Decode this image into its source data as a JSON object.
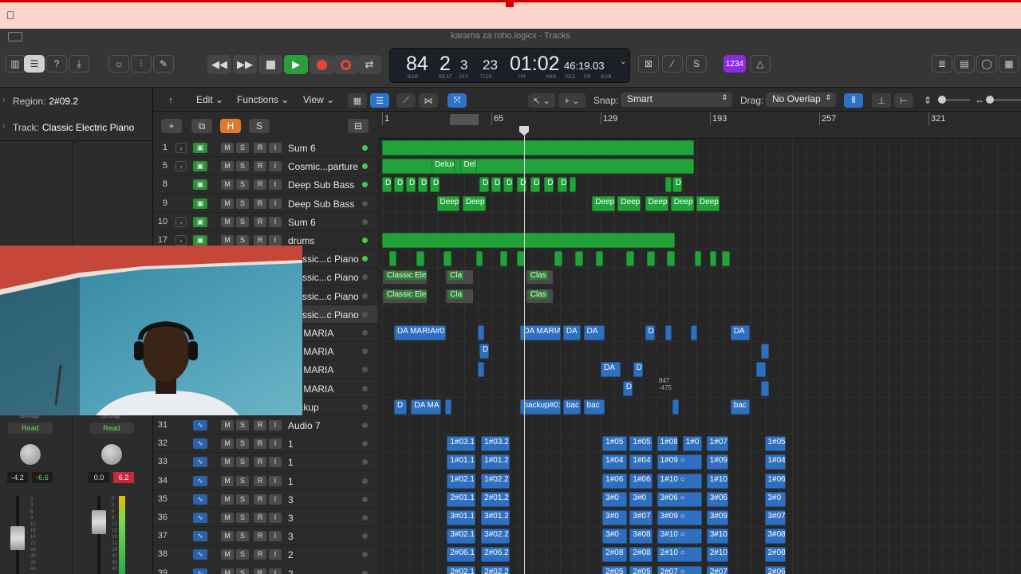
{
  "window": {
    "title": "karama za roho.logicx - Tracks"
  },
  "lcd": {
    "bar": "84",
    "beat": "2",
    "div": "3",
    "tick": "23",
    "time": "01:02",
    "time_small": "46:19.03",
    "labels": {
      "bar": "BAR",
      "beat": "BEAT",
      "div": "DIV",
      "tick": "TICK",
      "hr": "HR",
      "min": "MIN",
      "sec": "SEC",
      "fr": "FR",
      "sub": "SUB"
    }
  },
  "count_in": {
    "label": "1234"
  },
  "master_volume": {
    "level": 0.67
  },
  "inspector": {
    "region_label": "Region:",
    "region_value": "2#09.2",
    "track_label": "Track:",
    "track_value": "Classic Electric Piano",
    "strip_left": {
      "group": "Group",
      "automation": "Read",
      "vol": "-4.2",
      "peak": "-6.6"
    },
    "strip_right": {
      "group": "Group",
      "automation": "Read",
      "vol": "0.0",
      "peak": "6.2"
    }
  },
  "toolbar": {
    "edit": "Edit",
    "functions": "Functions",
    "view": "View",
    "snap_label": "Snap:",
    "snap_value": "Smart",
    "drag_label": "Drag:",
    "drag_value": "No Overlap"
  },
  "header_buttons": {
    "add": "+",
    "dup": "⧉",
    "hide": "H",
    "solo": "S"
  },
  "ruler": {
    "bars": [
      "1",
      "65",
      "129",
      "193",
      "257",
      "321"
    ]
  },
  "track_buttons": {
    "m": "M",
    "s": "S",
    "r": "R",
    "i": "I"
  },
  "tracks": [
    {
      "num": "1",
      "name": "Sum 6",
      "type": "inst",
      "stack": true,
      "led": true
    },
    {
      "num": "5",
      "name": "Cosmic...parture",
      "type": "inst",
      "stack": true,
      "led": true
    },
    {
      "num": "8",
      "name": "Deep Sub Bass",
      "type": "inst",
      "stack": false,
      "led": true
    },
    {
      "num": "9",
      "name": "Deep Sub Bass",
      "type": "inst",
      "stack": false,
      "led": false
    },
    {
      "num": "10",
      "name": "Sum 6",
      "type": "inst",
      "stack": true,
      "led": false
    },
    {
      "num": "17",
      "name": "drums",
      "type": "inst",
      "stack": true,
      "led": true
    },
    {
      "num": "",
      "name": "Classic...c Piano",
      "type": "inst",
      "stack": false,
      "led": true
    },
    {
      "num": "",
      "name": "Classic...c Piano",
      "type": "inst",
      "stack": false,
      "led": false
    },
    {
      "num": "",
      "name": "Classic...c Piano",
      "type": "inst",
      "stack": false,
      "led": false
    },
    {
      "num": "",
      "name": "Classic...c Piano",
      "type": "inst",
      "stack": false,
      "led": false
    },
    {
      "num": "",
      "name": "DA MARIA",
      "type": "audio",
      "stack": false,
      "led": false
    },
    {
      "num": "",
      "name": "DA MARIA",
      "type": "audio",
      "stack": false,
      "led": false
    },
    {
      "num": "",
      "name": "DA MARIA",
      "type": "audio",
      "stack": false,
      "led": false
    },
    {
      "num": "",
      "name": "DA MARIA",
      "type": "audio",
      "stack": false,
      "led": false
    },
    {
      "num": "",
      "name": "backup",
      "type": "audio",
      "stack": false,
      "led": false
    },
    {
      "num": "31",
      "name": "Audio 7",
      "type": "audio",
      "stack": false,
      "led": false
    },
    {
      "num": "32",
      "name": "1",
      "type": "audio",
      "stack": false,
      "led": false
    },
    {
      "num": "33",
      "name": "1",
      "type": "audio",
      "stack": false,
      "led": false
    },
    {
      "num": "34",
      "name": "1",
      "type": "audio",
      "stack": false,
      "led": false
    },
    {
      "num": "35",
      "name": "3",
      "type": "audio",
      "stack": false,
      "led": false
    },
    {
      "num": "36",
      "name": "3",
      "type": "audio",
      "stack": false,
      "led": false
    },
    {
      "num": "37",
      "name": "3",
      "type": "audio",
      "stack": false,
      "led": false
    },
    {
      "num": "38",
      "name": "2",
      "type": "audio",
      "stack": false,
      "led": false
    },
    {
      "num": "39",
      "name": "2",
      "type": "audio",
      "stack": false,
      "led": false
    }
  ],
  "regions": [
    {
      "lane": 0,
      "bar": 1,
      "len": 183,
      "label": "",
      "color": "g"
    },
    {
      "lane": 1,
      "bar": 1,
      "len": 183,
      "label": "",
      "color": "g"
    },
    {
      "lane": 1,
      "bar": 30,
      "len": 14,
      "label": "Deluxe",
      "color": "g"
    },
    {
      "lane": 1,
      "bar": 47,
      "len": 10,
      "label": "Delu",
      "color": "g"
    },
    {
      "lane": 2,
      "bar": 1,
      "len": 6,
      "label": "D",
      "color": "g"
    },
    {
      "lane": 2,
      "bar": 8,
      "len": 6,
      "label": "D",
      "color": "g"
    },
    {
      "lane": 2,
      "bar": 15,
      "len": 6,
      "label": "D",
      "color": "g"
    },
    {
      "lane": 2,
      "bar": 22,
      "len": 6,
      "label": "D",
      "color": "g"
    },
    {
      "lane": 2,
      "bar": 29,
      "len": 6,
      "label": "D",
      "color": "g"
    },
    {
      "lane": 2,
      "bar": 58,
      "len": 6,
      "label": "D",
      "color": "g"
    },
    {
      "lane": 2,
      "bar": 65,
      "len": 6,
      "label": "D",
      "color": "g"
    },
    {
      "lane": 2,
      "bar": 72,
      "len": 6,
      "label": "D",
      "color": "g"
    },
    {
      "lane": 2,
      "bar": 80,
      "len": 6,
      "label": "D",
      "color": "g"
    },
    {
      "lane": 2,
      "bar": 88,
      "len": 6,
      "label": "D",
      "color": "g"
    },
    {
      "lane": 2,
      "bar": 96,
      "len": 6,
      "label": "D",
      "color": "g"
    },
    {
      "lane": 2,
      "bar": 104,
      "len": 6,
      "label": "D",
      "color": "g"
    },
    {
      "lane": 2,
      "bar": 111,
      "len": 3,
      "label": "",
      "color": "g"
    },
    {
      "lane": 2,
      "bar": 167,
      "len": 3,
      "label": "",
      "color": "g"
    },
    {
      "lane": 2,
      "bar": 171,
      "len": 6,
      "label": "D",
      "color": "g"
    },
    {
      "lane": 3,
      "bar": 33,
      "len": 14,
      "label": "Deep",
      "color": "g"
    },
    {
      "lane": 3,
      "bar": 48,
      "len": 14,
      "label": "Deep",
      "color": "g"
    },
    {
      "lane": 3,
      "bar": 124,
      "len": 14,
      "label": "Deep",
      "color": "g"
    },
    {
      "lane": 3,
      "bar": 139,
      "len": 14,
      "label": "Deep",
      "color": "g"
    },
    {
      "lane": 3,
      "bar": 155,
      "len": 14,
      "label": "Deep",
      "color": "g"
    },
    {
      "lane": 3,
      "bar": 170,
      "len": 14,
      "label": "Deep",
      "color": "g"
    },
    {
      "lane": 3,
      "bar": 185,
      "len": 14,
      "label": "Deep",
      "color": "g"
    },
    {
      "lane": 5,
      "bar": 1,
      "len": 172,
      "label": "",
      "color": "g"
    },
    {
      "lane": 6,
      "bar": 5,
      "len": 5,
      "label": "",
      "color": "g"
    },
    {
      "lane": 6,
      "bar": 21,
      "len": 5,
      "label": "",
      "color": "g"
    },
    {
      "lane": 6,
      "bar": 37,
      "len": 5,
      "label": "",
      "color": "g"
    },
    {
      "lane": 6,
      "bar": 56,
      "len": 3,
      "label": "",
      "color": "g"
    },
    {
      "lane": 6,
      "bar": 70,
      "len": 5,
      "label": "",
      "color": "g"
    },
    {
      "lane": 6,
      "bar": 80,
      "len": 5,
      "label": "",
      "color": "g"
    },
    {
      "lane": 6,
      "bar": 102,
      "len": 5,
      "label": "",
      "color": "g"
    },
    {
      "lane": 6,
      "bar": 114,
      "len": 5,
      "label": "",
      "color": "g"
    },
    {
      "lane": 6,
      "bar": 126,
      "len": 5,
      "label": "",
      "color": "g"
    },
    {
      "lane": 6,
      "bar": 144,
      "len": 5,
      "label": "",
      "color": "g"
    },
    {
      "lane": 6,
      "bar": 156,
      "len": 5,
      "label": "",
      "color": "g"
    },
    {
      "lane": 6,
      "bar": 168,
      "len": 5,
      "label": "",
      "color": "g"
    },
    {
      "lane": 6,
      "bar": 184,
      "len": 3,
      "label": "",
      "color": "g"
    },
    {
      "lane": 6,
      "bar": 193,
      "len": 3,
      "label": "",
      "color": "g"
    },
    {
      "lane": 6,
      "bar": 200,
      "len": 5,
      "label": "",
      "color": "g"
    },
    {
      "lane": 7,
      "bar": 1,
      "len": 27,
      "label": "Classic Elec",
      "color": "gr"
    },
    {
      "lane": 7,
      "bar": 38,
      "len": 17,
      "label": "Cla",
      "color": "gr"
    },
    {
      "lane": 7,
      "bar": 85,
      "len": 17,
      "label": "Clas",
      "color": "gr"
    },
    {
      "lane": 8,
      "bar": 1,
      "len": 27,
      "label": "Classic Elec",
      "color": "gr"
    },
    {
      "lane": 8,
      "bar": 38,
      "len": 17,
      "label": "Cla",
      "color": "gr"
    },
    {
      "lane": 8,
      "bar": 85,
      "len": 17,
      "label": "Clas",
      "color": "gr"
    },
    {
      "lane": 10,
      "bar": 8,
      "len": 31,
      "label": "DA MARIA#03",
      "color": "b"
    },
    {
      "lane": 10,
      "bar": 57,
      "len": 3,
      "label": "",
      "color": "b"
    },
    {
      "lane": 10,
      "bar": 82,
      "len": 24,
      "label": "DA MARIA",
      "color": "b"
    },
    {
      "lane": 10,
      "bar": 107,
      "len": 11,
      "label": "DA",
      "color": "b"
    },
    {
      "lane": 10,
      "bar": 119,
      "len": 13,
      "label": "DA",
      "color": "b"
    },
    {
      "lane": 10,
      "bar": 155,
      "len": 6,
      "label": "D",
      "color": "b"
    },
    {
      "lane": 10,
      "bar": 167,
      "len": 3,
      "label": "",
      "color": "b"
    },
    {
      "lane": 10,
      "bar": 182,
      "len": 3,
      "label": "",
      "color": "b"
    },
    {
      "lane": 10,
      "bar": 205,
      "len": 12,
      "label": "DA",
      "color": "b"
    },
    {
      "lane": 11,
      "bar": 58,
      "len": 6,
      "label": "D",
      "color": "b"
    },
    {
      "lane": 11,
      "bar": 223,
      "len": 5,
      "label": "",
      "color": "b"
    },
    {
      "lane": 12,
      "bar": 57,
      "len": 3,
      "label": "",
      "color": "b"
    },
    {
      "lane": 12,
      "bar": 129,
      "len": 12,
      "label": "DA",
      "color": "b"
    },
    {
      "lane": 12,
      "bar": 148,
      "len": 6,
      "label": "D",
      "color": "b"
    },
    {
      "lane": 12,
      "bar": 220,
      "len": 6,
      "label": "",
      "color": "b"
    },
    {
      "lane": 13,
      "bar": 142,
      "len": 6,
      "label": "D",
      "color": "b"
    },
    {
      "lane": 13,
      "bar": 223,
      "len": 5,
      "label": "",
      "color": "b"
    },
    {
      "lane": 14,
      "bar": 8,
      "len": 8,
      "label": "D",
      "color": "b"
    },
    {
      "lane": 14,
      "bar": 18,
      "len": 18,
      "label": "DA MA",
      "color": "b"
    },
    {
      "lane": 14,
      "bar": 38,
      "len": 3,
      "label": "",
      "color": "b"
    },
    {
      "lane": 14,
      "bar": 82,
      "len": 24,
      "label": "backup#01",
      "color": "b"
    },
    {
      "lane": 14,
      "bar": 107,
      "len": 11,
      "label": "bac",
      "color": "b"
    },
    {
      "lane": 14,
      "bar": 119,
      "len": 13,
      "label": "bac",
      "color": "b"
    },
    {
      "lane": 14,
      "bar": 171,
      "len": 3,
      "label": "",
      "color": "b"
    },
    {
      "lane": 14,
      "bar": 205,
      "len": 12,
      "label": "bac",
      "color": "b"
    },
    {
      "lane": 16,
      "bar": 39,
      "len": 17,
      "label": "1#03.1",
      "color": "b"
    },
    {
      "lane": 16,
      "bar": 59,
      "len": 17,
      "label": "1#03.2",
      "color": "b"
    },
    {
      "lane": 16,
      "bar": 130,
      "len": 15,
      "label": "1#05",
      "color": "b"
    },
    {
      "lane": 16,
      "bar": 146,
      "len": 14,
      "label": "1#05.",
      "color": "b"
    },
    {
      "lane": 16,
      "bar": 162,
      "len": 13,
      "label": "1#08",
      "color": "b"
    },
    {
      "lane": 16,
      "bar": 177,
      "len": 12,
      "label": "1#0",
      "color": "b"
    },
    {
      "lane": 16,
      "bar": 191,
      "len": 13,
      "label": "1#07.",
      "color": "b"
    },
    {
      "lane": 16,
      "bar": 225,
      "len": 13,
      "label": "1#05",
      "color": "b"
    },
    {
      "lane": 17,
      "bar": 39,
      "len": 17,
      "label": "1#01.1",
      "color": "b"
    },
    {
      "lane": 17,
      "bar": 59,
      "len": 17,
      "label": "1#01.2",
      "color": "b"
    },
    {
      "lane": 17,
      "bar": 130,
      "len": 15,
      "label": "1#04",
      "color": "b"
    },
    {
      "lane": 17,
      "bar": 146,
      "len": 14,
      "label": "1#04",
      "color": "b"
    },
    {
      "lane": 17,
      "bar": 162,
      "len": 27,
      "label": "1#09 ○",
      "color": "b"
    },
    {
      "lane": 17,
      "bar": 191,
      "len": 13,
      "label": "1#09.",
      "color": "b"
    },
    {
      "lane": 17,
      "bar": 225,
      "len": 13,
      "label": "1#04",
      "color": "b"
    },
    {
      "lane": 18,
      "bar": 39,
      "len": 17,
      "label": "1#02.1",
      "color": "b"
    },
    {
      "lane": 18,
      "bar": 59,
      "len": 17,
      "label": "1#02.2",
      "color": "b"
    },
    {
      "lane": 18,
      "bar": 130,
      "len": 15,
      "label": "1#06",
      "color": "b"
    },
    {
      "lane": 18,
      "bar": 146,
      "len": 14,
      "label": "1#06.",
      "color": "b"
    },
    {
      "lane": 18,
      "bar": 162,
      "len": 27,
      "label": "1#10 ○",
      "color": "b"
    },
    {
      "lane": 18,
      "bar": 191,
      "len": 13,
      "label": "1#10.",
      "color": "b"
    },
    {
      "lane": 18,
      "bar": 225,
      "len": 13,
      "label": "1#06",
      "color": "b"
    },
    {
      "lane": 19,
      "bar": 39,
      "len": 17,
      "label": "2#01.1",
      "color": "b"
    },
    {
      "lane": 19,
      "bar": 59,
      "len": 17,
      "label": "2#01.2",
      "color": "b"
    },
    {
      "lane": 19,
      "bar": 130,
      "len": 15,
      "label": "3#0",
      "color": "b"
    },
    {
      "lane": 19,
      "bar": 146,
      "len": 14,
      "label": "3#0",
      "color": "b"
    },
    {
      "lane": 19,
      "bar": 162,
      "len": 27,
      "label": "3#06 ○",
      "color": "b"
    },
    {
      "lane": 19,
      "bar": 191,
      "len": 13,
      "label": "3#06",
      "color": "b"
    },
    {
      "lane": 19,
      "bar": 225,
      "len": 13,
      "label": "3#0",
      "color": "b"
    },
    {
      "lane": 20,
      "bar": 39,
      "len": 17,
      "label": "3#01.1",
      "color": "b"
    },
    {
      "lane": 20,
      "bar": 59,
      "len": 17,
      "label": "3#01.2",
      "color": "b"
    },
    {
      "lane": 20,
      "bar": 130,
      "len": 15,
      "label": "3#0",
      "color": "b"
    },
    {
      "lane": 20,
      "bar": 146,
      "len": 14,
      "label": "3#07",
      "color": "b"
    },
    {
      "lane": 20,
      "bar": 162,
      "len": 27,
      "label": "3#09 ○",
      "color": "b"
    },
    {
      "lane": 20,
      "bar": 191,
      "len": 13,
      "label": "3#09",
      "color": "b"
    },
    {
      "lane": 20,
      "bar": 225,
      "len": 13,
      "label": "3#07",
      "color": "b"
    },
    {
      "lane": 21,
      "bar": 39,
      "len": 17,
      "label": "3#02.1",
      "color": "b"
    },
    {
      "lane": 21,
      "bar": 59,
      "len": 17,
      "label": "3#02.2",
      "color": "b"
    },
    {
      "lane": 21,
      "bar": 130,
      "len": 15,
      "label": "3#0",
      "color": "b"
    },
    {
      "lane": 21,
      "bar": 146,
      "len": 14,
      "label": "3#08",
      "color": "b"
    },
    {
      "lane": 21,
      "bar": 162,
      "len": 27,
      "label": "3#10 ○",
      "color": "b"
    },
    {
      "lane": 21,
      "bar": 191,
      "len": 13,
      "label": "3#10.",
      "color": "b"
    },
    {
      "lane": 21,
      "bar": 225,
      "len": 13,
      "label": "3#08",
      "color": "b"
    },
    {
      "lane": 22,
      "bar": 39,
      "len": 17,
      "label": "2#06.1",
      "color": "b"
    },
    {
      "lane": 22,
      "bar": 59,
      "len": 17,
      "label": "2#06.2",
      "color": "b"
    },
    {
      "lane": 22,
      "bar": 130,
      "len": 15,
      "label": "2#08",
      "color": "b"
    },
    {
      "lane": 22,
      "bar": 146,
      "len": 14,
      "label": "2#08",
      "color": "b"
    },
    {
      "lane": 22,
      "bar": 162,
      "len": 27,
      "label": "2#10 ○",
      "color": "b"
    },
    {
      "lane": 22,
      "bar": 191,
      "len": 13,
      "label": "2#10.",
      "color": "b"
    },
    {
      "lane": 22,
      "bar": 225,
      "len": 13,
      "label": "2#08",
      "color": "b"
    },
    {
      "lane": 23,
      "bar": 39,
      "len": 17,
      "label": "2#02.1",
      "color": "b"
    },
    {
      "lane": 23,
      "bar": 59,
      "len": 17,
      "label": "2#02.2",
      "color": "b"
    },
    {
      "lane": 23,
      "bar": 130,
      "len": 15,
      "label": "2#05",
      "color": "b"
    },
    {
      "lane": 23,
      "bar": 146,
      "len": 14,
      "label": "2#05",
      "color": "b"
    },
    {
      "lane": 23,
      "bar": 162,
      "len": 27,
      "label": "2#07 ○",
      "color": "b"
    },
    {
      "lane": 23,
      "bar": 191,
      "len": 13,
      "label": "2#07",
      "color": "b"
    },
    {
      "lane": 23,
      "bar": 225,
      "len": 13,
      "label": "2#06",
      "color": "b"
    }
  ],
  "position_tooltip": {
    "line1": "847",
    "line2": "-475"
  }
}
